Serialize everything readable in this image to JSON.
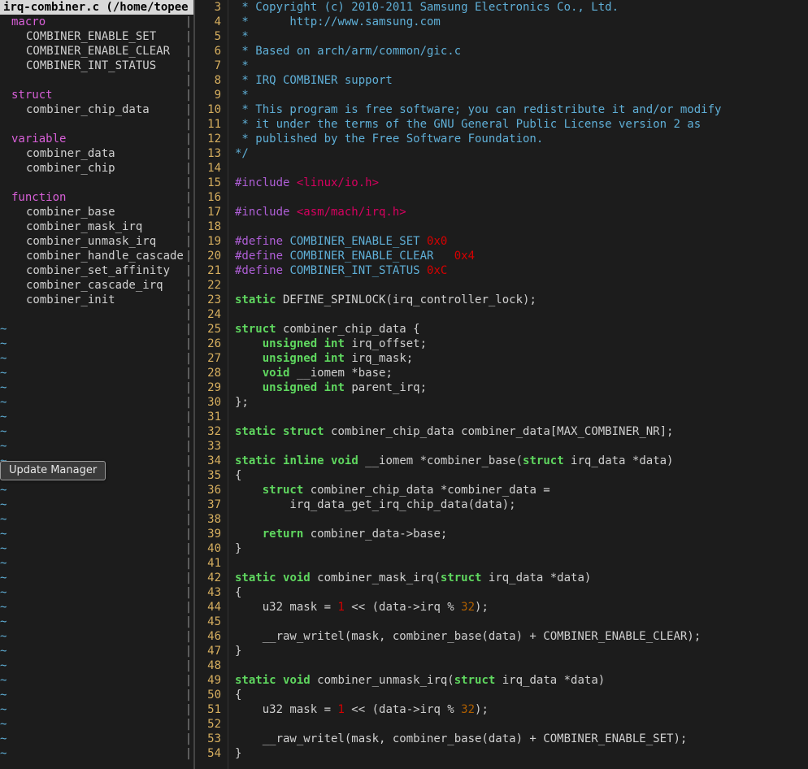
{
  "tab": {
    "title": "irq-combiner.c (/home/topee"
  },
  "popup": {
    "label": "Update Manager"
  },
  "outline": {
    "sections": [
      {
        "name": "macro",
        "items": [
          "COMBINER_ENABLE_SET",
          "COMBINER_ENABLE_CLEAR",
          "COMBINER_INT_STATUS"
        ]
      },
      {
        "name": "struct",
        "items": [
          "combiner_chip_data"
        ]
      },
      {
        "name": "variable",
        "items": [
          "combiner_data",
          "combiner_chip"
        ]
      },
      {
        "name": "function",
        "items": [
          "combiner_base",
          "combiner_mask_irq",
          "combiner_unmask_irq",
          "combiner_handle_cascade",
          "combiner_set_affinity",
          "combiner_cascade_irq",
          "combiner_init"
        ]
      }
    ]
  },
  "gutter_start": 3,
  "gutter_end": 54,
  "code_lines": [
    [
      [
        "c-comment",
        " * Copyright (c) 2010-2011 Samsung Electronics Co., Ltd."
      ]
    ],
    [
      [
        "c-comment",
        " *      http://www.samsung.com"
      ]
    ],
    [
      [
        "c-comment",
        " *"
      ]
    ],
    [
      [
        "c-comment",
        " * Based on arch/arm/common/gic.c"
      ]
    ],
    [
      [
        "c-comment",
        " *"
      ]
    ],
    [
      [
        "c-comment",
        " * IRQ COMBINER support"
      ]
    ],
    [
      [
        "c-comment",
        " *"
      ]
    ],
    [
      [
        "c-comment",
        " * This program is free software; you can redistribute it and/or modify"
      ]
    ],
    [
      [
        "c-comment",
        " * it under the terms of the GNU General Public License version 2 as"
      ]
    ],
    [
      [
        "c-comment",
        " * published by the Free Software Foundation."
      ]
    ],
    [
      [
        "c-comment",
        "*/"
      ]
    ],
    [],
    [
      [
        "c-preproc",
        "#include "
      ],
      [
        "c-string",
        "<linux/io.h>"
      ]
    ],
    [],
    [
      [
        "c-preproc",
        "#include "
      ],
      [
        "c-string",
        "<asm/mach/irq.h>"
      ]
    ],
    [],
    [
      [
        "c-preproc",
        "#define "
      ],
      [
        "c-macro",
        "COMBINER_ENABLE_SET"
      ],
      [
        "",
        " "
      ],
      [
        "c-number",
        "0x0"
      ]
    ],
    [
      [
        "c-preproc",
        "#define "
      ],
      [
        "c-macro",
        "COMBINER_ENABLE_CLEAR"
      ],
      [
        "",
        "   "
      ],
      [
        "c-number",
        "0x4"
      ]
    ],
    [
      [
        "c-preproc",
        "#define "
      ],
      [
        "c-macro",
        "COMBINER_INT_STATUS"
      ],
      [
        "",
        " "
      ],
      [
        "c-number",
        "0xC"
      ]
    ],
    [],
    [
      [
        "c-keyword",
        "static"
      ],
      [
        "",
        " DEFINE_SPINLOCK(irq_controller_lock);"
      ]
    ],
    [],
    [
      [
        "c-keyword",
        "struct"
      ],
      [
        "",
        " combiner_chip_data {"
      ]
    ],
    [
      [
        "",
        "    "
      ],
      [
        "c-keyword",
        "unsigned"
      ],
      [
        "",
        " "
      ],
      [
        "c-type",
        "int"
      ],
      [
        "",
        " irq_offset;"
      ]
    ],
    [
      [
        "",
        "    "
      ],
      [
        "c-keyword",
        "unsigned"
      ],
      [
        "",
        " "
      ],
      [
        "c-type",
        "int"
      ],
      [
        "",
        " irq_mask;"
      ]
    ],
    [
      [
        "",
        "    "
      ],
      [
        "c-type",
        "void"
      ],
      [
        "",
        " __iomem *base;"
      ]
    ],
    [
      [
        "",
        "    "
      ],
      [
        "c-keyword",
        "unsigned"
      ],
      [
        "",
        " "
      ],
      [
        "c-type",
        "int"
      ],
      [
        "",
        " parent_irq;"
      ]
    ],
    [
      [
        "",
        "};"
      ]
    ],
    [],
    [
      [
        "c-keyword",
        "static"
      ],
      [
        "",
        " "
      ],
      [
        "c-keyword",
        "struct"
      ],
      [
        "",
        " combiner_chip_data combiner_data[MAX_COMBINER_NR];"
      ]
    ],
    [],
    [
      [
        "c-keyword",
        "static"
      ],
      [
        "",
        " "
      ],
      [
        "c-keyword",
        "inline"
      ],
      [
        "",
        " "
      ],
      [
        "c-type",
        "void"
      ],
      [
        "",
        " __iomem *combiner_base("
      ],
      [
        "c-keyword",
        "struct"
      ],
      [
        "",
        " irq_data *data)"
      ]
    ],
    [
      [
        "",
        "{"
      ]
    ],
    [
      [
        "",
        "    "
      ],
      [
        "c-keyword",
        "struct"
      ],
      [
        "",
        " combiner_chip_data *combiner_data ="
      ]
    ],
    [
      [
        "",
        "        irq_data_get_irq_chip_data(data);"
      ]
    ],
    [],
    [
      [
        "",
        "    "
      ],
      [
        "c-keyword",
        "return"
      ],
      [
        "",
        " combiner_data->base;"
      ]
    ],
    [
      [
        "",
        "}"
      ]
    ],
    [],
    [
      [
        "c-keyword",
        "static"
      ],
      [
        "",
        " "
      ],
      [
        "c-type",
        "void"
      ],
      [
        "",
        " combiner_mask_irq("
      ],
      [
        "c-keyword",
        "struct"
      ],
      [
        "",
        " irq_data *data)"
      ]
    ],
    [
      [
        "",
        "{"
      ]
    ],
    [
      [
        "",
        "    u32 mask = "
      ],
      [
        "c-number",
        "1"
      ],
      [
        "",
        " << (data->irq % "
      ],
      [
        "c-number2",
        "32"
      ],
      [
        "",
        ");"
      ]
    ],
    [],
    [
      [
        "",
        "    __raw_writel(mask, combiner_base(data) + COMBINER_ENABLE_CLEAR);"
      ]
    ],
    [
      [
        "",
        "}"
      ]
    ],
    [],
    [
      [
        "c-keyword",
        "static"
      ],
      [
        "",
        " "
      ],
      [
        "c-type",
        "void"
      ],
      [
        "",
        " combiner_unmask_irq("
      ],
      [
        "c-keyword",
        "struct"
      ],
      [
        "",
        " irq_data *data)"
      ]
    ],
    [
      [
        "",
        "{"
      ]
    ],
    [
      [
        "",
        "    u32 mask = "
      ],
      [
        "c-number",
        "1"
      ],
      [
        "",
        " << (data->irq % "
      ],
      [
        "c-number2",
        "32"
      ],
      [
        "",
        ");"
      ]
    ],
    [],
    [
      [
        "",
        "    __raw_writel(mask, combiner_base(data) + COMBINER_ENABLE_SET);"
      ]
    ],
    [
      [
        "",
        "}"
      ]
    ]
  ]
}
